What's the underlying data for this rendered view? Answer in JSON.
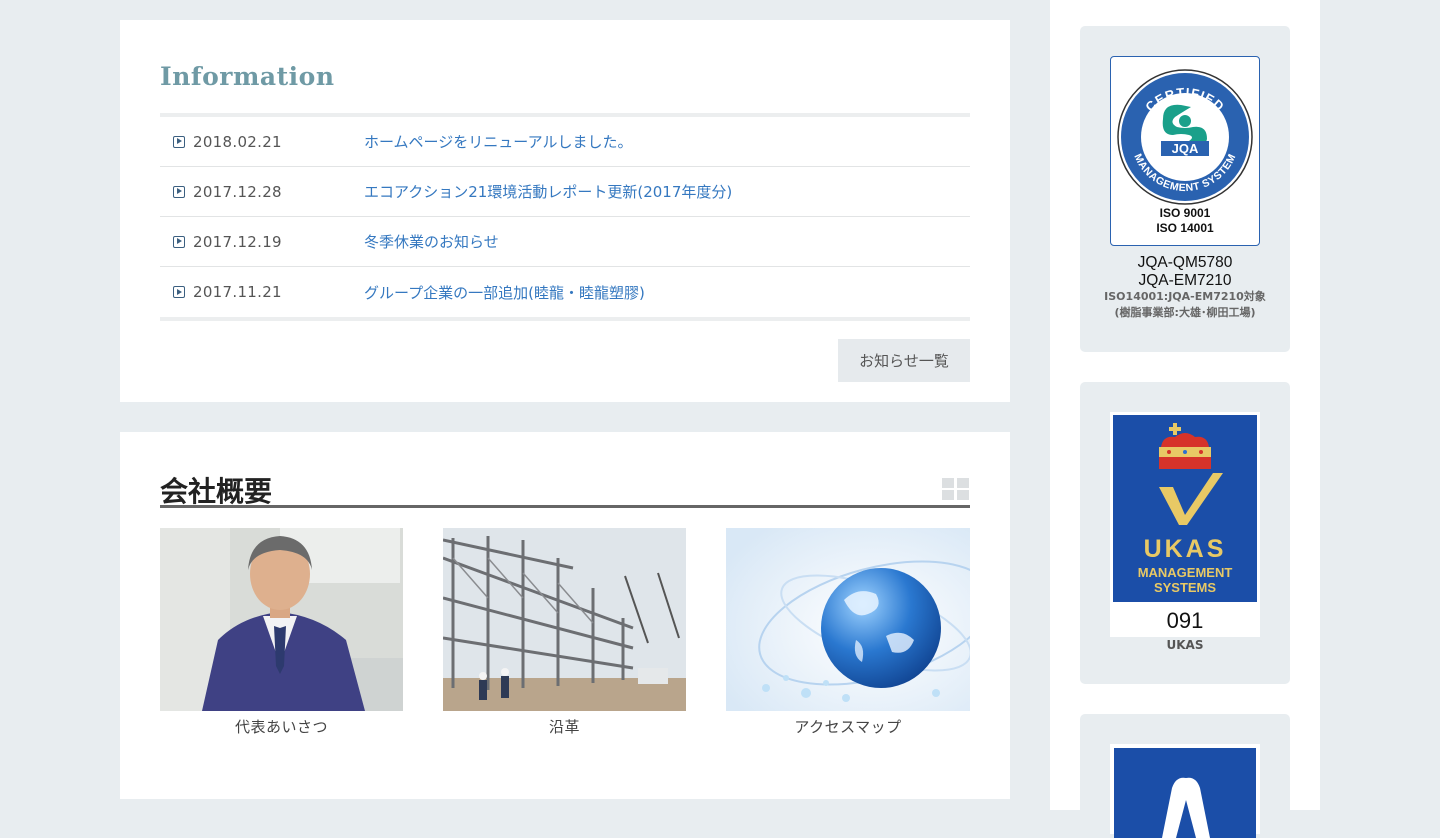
{
  "information": {
    "title": "Information",
    "news": [
      {
        "date": "2018.02.21",
        "text": "ホームページをリニューアルしました。"
      },
      {
        "date": "2017.12.28",
        "text": "エコアクション21環境活動レポート更新(2017年度分)"
      },
      {
        "date": "2017.12.19",
        "text": "冬季休業のお知らせ"
      },
      {
        "date": "2017.11.21",
        "text": "グループ企業の一部追加(睦龍・睦龍塑膠)"
      }
    ],
    "more_label": "お知らせ一覧"
  },
  "company": {
    "title": "会社概要",
    "cards": [
      {
        "caption": "代表あいさつ"
      },
      {
        "caption": "沿革"
      },
      {
        "caption": "アクセスマップ"
      }
    ]
  },
  "sidebar": {
    "jqa": {
      "ring_top": "CERTIFIED",
      "ring_bottom": "MANAGEMENT SYSTEM",
      "mark": "JQA",
      "iso1": "ISO 9001",
      "iso2": "ISO 14001",
      "code1": "JQA-QM5780",
      "code2": "JQA-EM7210",
      "note1": "ISO14001:JQA-EM7210対象",
      "note2": "(樹脂事業部:大雄･柳田工場)"
    },
    "ukas": {
      "word": "UKAS",
      "line1": "MANAGEMENT",
      "line2": "SYSTEMS",
      "number": "091",
      "label": "UKAS"
    },
    "colors": {
      "ukas_blue": "#1b4ea8",
      "ukas_gold": "#e8c965",
      "jqa_blue": "#2a62b0",
      "jqa_green": "#1aa08a"
    }
  }
}
